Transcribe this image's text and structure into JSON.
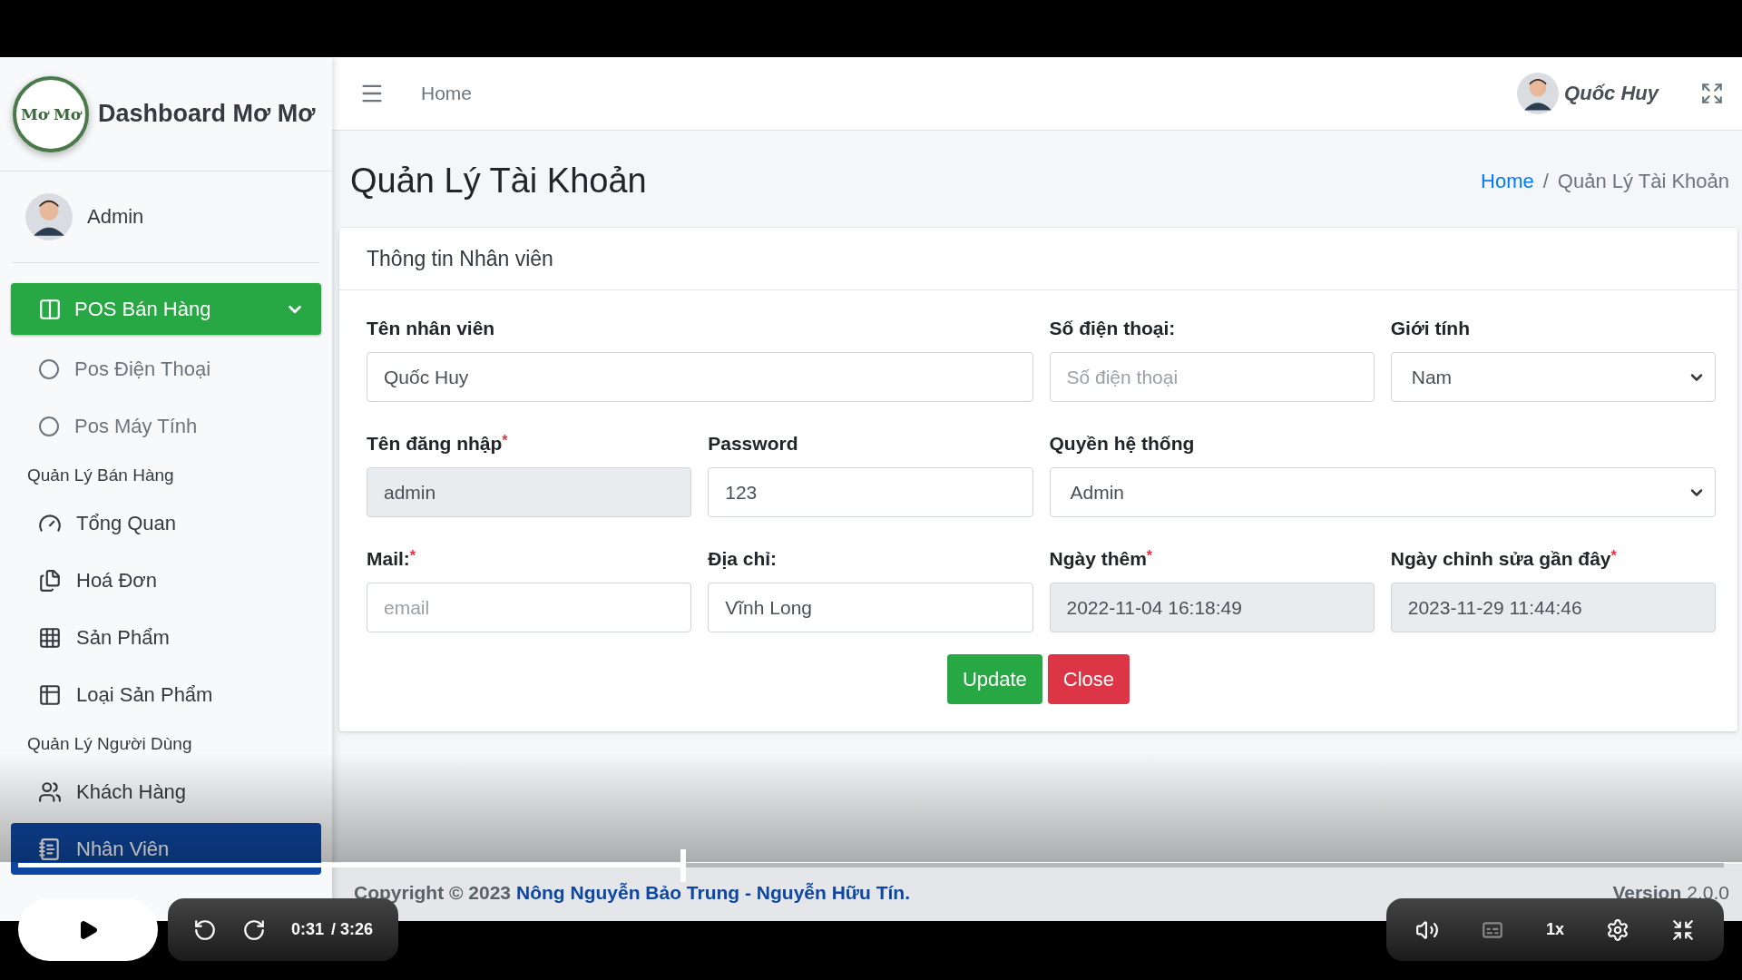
{
  "sidebar": {
    "logo_text": "Mơ Mơ",
    "brand": "Dashboard Mơ Mơ",
    "user": "Admin",
    "items": [
      {
        "kind": "group",
        "label": "POS Bán Hàng",
        "expanded": true
      },
      {
        "kind": "sub",
        "label": "Pos Điện Thoại"
      },
      {
        "kind": "sub",
        "label": "Pos Máy Tính"
      },
      {
        "kind": "header",
        "label": "Quản Lý Bán Hàng"
      },
      {
        "kind": "link",
        "label": "Tổng Quan",
        "selected": false
      },
      {
        "kind": "link",
        "label": "Hoá Đơn",
        "selected": false
      },
      {
        "kind": "link",
        "label": "Sản Phẩm",
        "selected": false
      },
      {
        "kind": "link",
        "label": "Loại Sản Phẩm",
        "selected": false
      },
      {
        "kind": "header",
        "label": "Quản Lý Người Dùng"
      },
      {
        "kind": "link",
        "label": "Khách Hàng",
        "selected": false
      },
      {
        "kind": "link",
        "label": "Nhân Viên",
        "selected": true
      }
    ]
  },
  "navbar": {
    "link": "Home",
    "user": "Quốc Huy"
  },
  "page": {
    "title": "Quản Lý Tài Khoản",
    "separator": "/",
    "breadcrumb": [
      {
        "label": "Home",
        "link": true
      },
      {
        "label": "Quản Lý Tài Khoản",
        "link": false
      }
    ]
  },
  "card": {
    "title": "Thông tin Nhân viên",
    "fields": [
      {
        "kind": "text",
        "label": "Tên nhân viên",
        "value": "Quốc Huy",
        "disabled": false
      },
      {
        "kind": "text",
        "label": "Số điện thoại:",
        "placeholder": "Số điện thoại",
        "disabled": false
      },
      {
        "kind": "select",
        "label": "Giới tính",
        "value": "Nam",
        "disabled": false
      },
      {
        "kind": "text",
        "label": "Tên đăng nhập",
        "required_mark": "*",
        "value": "admin",
        "disabled": true
      },
      {
        "kind": "text",
        "label": "Password",
        "value": "123",
        "disabled": false
      },
      {
        "kind": "select",
        "label": "Quyền hệ thống",
        "value": "Admin",
        "disabled": false
      },
      {
        "kind": "text",
        "label": "Mail:",
        "required_mark": "*",
        "placeholder": "email",
        "disabled": false
      },
      {
        "kind": "text",
        "label": "Địa chỉ:",
        "value": "Vĩnh Long",
        "disabled": false
      },
      {
        "kind": "text",
        "label": "Ngày thêm",
        "required_mark": "*",
        "value": "2022-11-04 16:18:49",
        "disabled": true
      },
      {
        "kind": "text",
        "label": "Ngày chỉnh sửa gần đây",
        "required_mark": "*",
        "value": "2023-11-29 11:44:46",
        "disabled": true
      }
    ],
    "buttons": [
      {
        "kind": "success",
        "label": "Update"
      },
      {
        "kind": "danger",
        "label": "Close"
      }
    ]
  },
  "footer": {
    "copyright": "Copyright © 2023",
    "authors": "Nông Nguyễn Bảo Trung - Nguyễn Hữu Tín.",
    "version_label": "Version",
    "version": "2.0.0"
  },
  "player": {
    "level": 0.39,
    "elapsed": "0:31",
    "duration": "/ 3:26",
    "speed": "1x"
  }
}
